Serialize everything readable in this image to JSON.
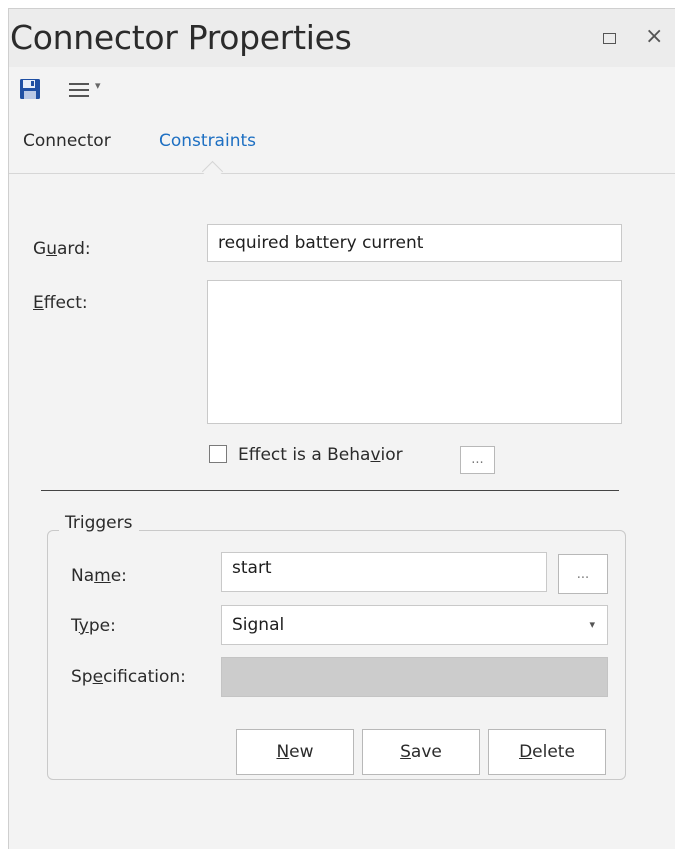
{
  "window": {
    "title": "Connector Properties"
  },
  "toolbar": {
    "save_icon": "save-icon",
    "menu_icon": "hamburger-menu-icon"
  },
  "tabs": [
    {
      "label": "Connector",
      "active": false
    },
    {
      "label": "Constraints",
      "active": true
    }
  ],
  "constraints": {
    "guard_label_pre": "G",
    "guard_label_u": "u",
    "guard_label_post": "ard:",
    "guard_value": "required battery current",
    "effect_label_u": "E",
    "effect_label_post": "ffect:",
    "effect_value": "",
    "behavior_checkbox": {
      "label_pre": "Effect is a Beha",
      "label_u": "v",
      "label_post": "ior",
      "checked": false
    },
    "ellipsis": "..."
  },
  "triggers": {
    "legend": "Triggers",
    "name_label_pre": "Na",
    "name_label_u": "m",
    "name_label_post": "e:",
    "name_value": "start",
    "type_label_pre": "T",
    "type_label_u": "y",
    "type_label_post": "pe:",
    "type_value": "Signal",
    "spec_label_pre": "Sp",
    "spec_label_u": "e",
    "spec_label_post": "cification:",
    "spec_value": "",
    "buttons": {
      "new_u": "N",
      "new_post": "ew",
      "save_u": "S",
      "save_post": "ave",
      "delete_u": "D",
      "delete_post": "elete"
    }
  },
  "colors": {
    "active_tab": "#1d6fc2",
    "panel_bg": "#f3f3f3",
    "disabled_field": "#cccccc"
  }
}
